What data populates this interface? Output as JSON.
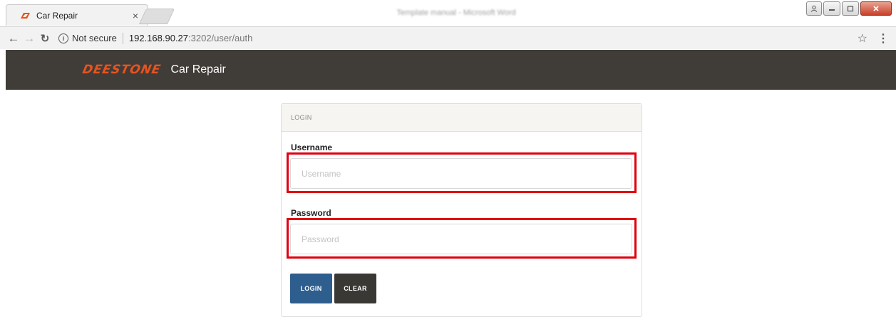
{
  "browser": {
    "tab_title": "Car Repair",
    "tab_close": "×",
    "window_title": "Template manual - Microsoft Word",
    "security_label": "Not secure",
    "url_host": "192.168.90.27",
    "url_path": ":3202/user/auth"
  },
  "navbar": {
    "logo_text": "DEESTONE",
    "app_name": "Car Repair"
  },
  "login_card": {
    "header": "LOGIN",
    "username_label": "Username",
    "username_placeholder": "Username",
    "username_value": "",
    "password_label": "Password",
    "password_placeholder": "Password",
    "password_value": "",
    "login_button": "LOGIN",
    "clear_button": "CLEAR"
  },
  "colors": {
    "navbar_bg": "#403d39",
    "logo_orange": "#e8531f",
    "login_button_bg": "#2e5e8e",
    "clear_button_bg": "#3a3835",
    "highlight_red": "#e1000f"
  }
}
